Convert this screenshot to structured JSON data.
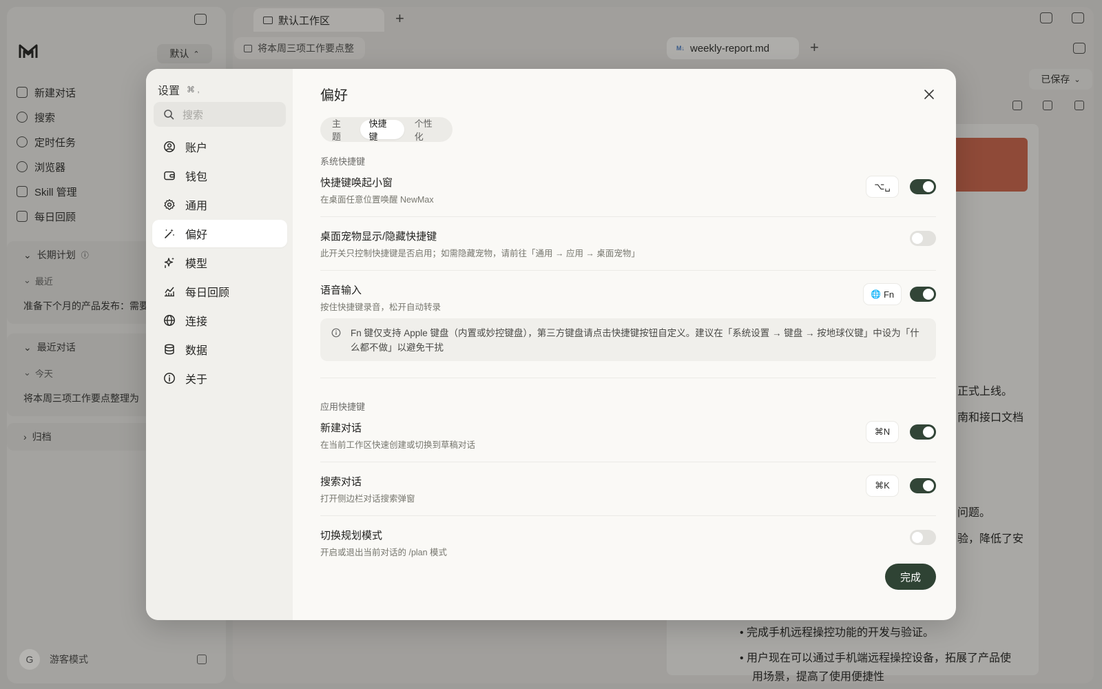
{
  "app": {
    "workspace_select": "默认",
    "workspace_tab": "默认工作区",
    "chat_tab": "将本周三项工作要点整",
    "doc_tab": "weekly-report.md",
    "saved_label": "已保存",
    "nav": [
      "新建对话",
      "搜索",
      "定时任务",
      "浏览器",
      "Skill 管理",
      "每日回顾"
    ],
    "groups": {
      "long_term": "长期计划",
      "recent": "最近",
      "recent_item": "准备下个月的产品发布：需要",
      "recent_chats": "最近对话",
      "today": "今天",
      "today_item": "将本周三项工作要点整理为",
      "archive": "归档"
    },
    "guest": {
      "initial": "G",
      "label": "游客模式"
    },
    "doc_lines": [
      "正式上线。",
      "南和接口文档",
      "问题。",
      "验，降低了安",
      "完成手机远程操控功能的开发与验证。",
      "用户现在可以通过手机端远程操控设备，拓展了产品使",
      "用场景，提高了使用便捷性"
    ]
  },
  "settings": {
    "title": "设置",
    "shortcut": "⌘ ,",
    "search_placeholder": "搜索",
    "nav": [
      {
        "label": "账户",
        "icon": "user-circle-icon"
      },
      {
        "label": "钱包",
        "icon": "wallet-icon"
      },
      {
        "label": "通用",
        "icon": "gear-icon"
      },
      {
        "label": "偏好",
        "icon": "magic-wand-icon"
      },
      {
        "label": "模型",
        "icon": "sparkles-icon"
      },
      {
        "label": "每日回顾",
        "icon": "chart-icon"
      },
      {
        "label": "连接",
        "icon": "globe-icon"
      },
      {
        "label": "数据",
        "icon": "database-icon"
      },
      {
        "label": "关于",
        "icon": "info-icon"
      }
    ],
    "active_nav": "偏好"
  },
  "pane": {
    "title": "偏好",
    "tabs": [
      "主题",
      "快捷键",
      "个性化"
    ],
    "active_tab": "快捷键",
    "system_section": "系统快捷键",
    "app_section": "应用快捷键",
    "rows": [
      {
        "title": "快捷键唤起小窗",
        "desc": "在桌面任意位置唤醒 NewMax",
        "key": "⌥␣",
        "enabled": true
      },
      {
        "title": "桌面宠物显示/隐藏快捷键",
        "desc": "此开关只控制快捷键是否启用；如需隐藏宠物，请前往「通用 → 应用 → 桌面宠物」",
        "key": "",
        "enabled": false
      },
      {
        "title": "语音输入",
        "desc": "按住快捷键录音，松开自动转录",
        "key": "Fn",
        "enabled": true
      },
      {
        "title": "新建对话",
        "desc": "在当前工作区快速创建或切换到草稿对话",
        "key": "⌘N",
        "enabled": true
      },
      {
        "title": "搜索对话",
        "desc": "打开侧边栏对话搜索弹窗",
        "key": "⌘K",
        "enabled": true
      },
      {
        "title": "切换规划模式",
        "desc": "开启或退出当前对话的 /plan 模式",
        "key": "",
        "enabled": false
      }
    ],
    "info_text": "Fn 键仅支持 Apple 键盘（内置或妙控键盘），第三方键盘请点击快捷键按钮自定义。建议在「系统设置 → 键盘 → 按地球仪键」中设为「什么都不做」以避免干扰",
    "done_label": "完成"
  },
  "colors": {
    "accent": "#2f4334",
    "toggle_off": "#e2e1dd",
    "modal_bg": "#faf9f6",
    "sidebar_bg": "#f1f0ec"
  }
}
